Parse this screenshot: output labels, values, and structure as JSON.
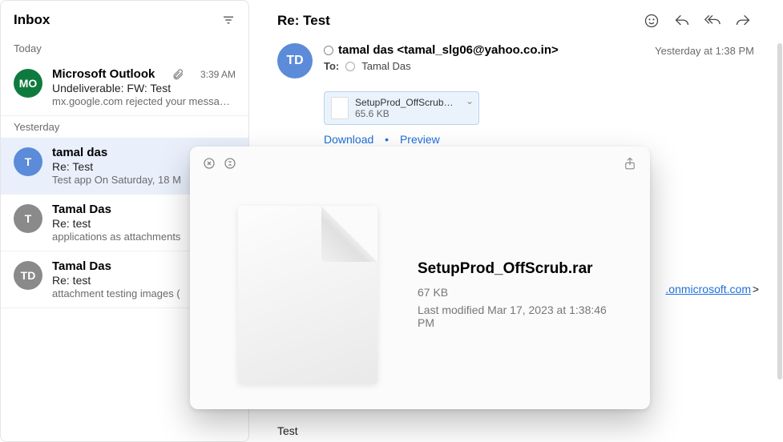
{
  "sidebar": {
    "title": "Inbox",
    "groups": [
      {
        "label": "Today",
        "items": [
          {
            "avatar_text": "MO",
            "avatar_bg": "#0f7a3d",
            "sender": "Microsoft Outlook",
            "time": "3:39 AM",
            "has_attachment": true,
            "subject": "Undeliverable: FW: Test",
            "preview": "mx.google.com rejected your messa…"
          }
        ]
      },
      {
        "label": "Yesterday",
        "items": [
          {
            "avatar_text": "T",
            "avatar_bg": "#5b8bd9",
            "sender": "tamal das",
            "subject": "Re: Test",
            "preview": "Test app On Saturday, 18 M",
            "selected": true
          },
          {
            "avatar_text": "T",
            "avatar_bg": "#8a8a8a",
            "sender": "Tamal Das",
            "subject": "Re: test",
            "preview": "applications as attachments"
          },
          {
            "avatar_text": "TD",
            "avatar_bg": "#8a8a8a",
            "sender": "Tamal Das",
            "subject": "Re: test",
            "preview": "attachment testing images ("
          }
        ]
      }
    ]
  },
  "message": {
    "title": "Re: Test",
    "avatar_text": "TD",
    "from": "tamal das <tamal_slg06@yahoo.co.in>",
    "to_label": "To:",
    "to_name": "Tamal Das",
    "timestamp": "Yesterday at 1:38 PM",
    "attachment": {
      "name": "SetupProd_OffScrub…",
      "size": "65.6 KB"
    },
    "download_label": "Download",
    "preview_label": "Preview",
    "ext_link": ".onmicrosoft.com",
    "body": "Test"
  },
  "quicklook": {
    "filename": "SetupProd_OffScrub.rar",
    "size": "67 KB",
    "modified": "Last modified Mar 17, 2023 at 1:38:46 PM"
  }
}
